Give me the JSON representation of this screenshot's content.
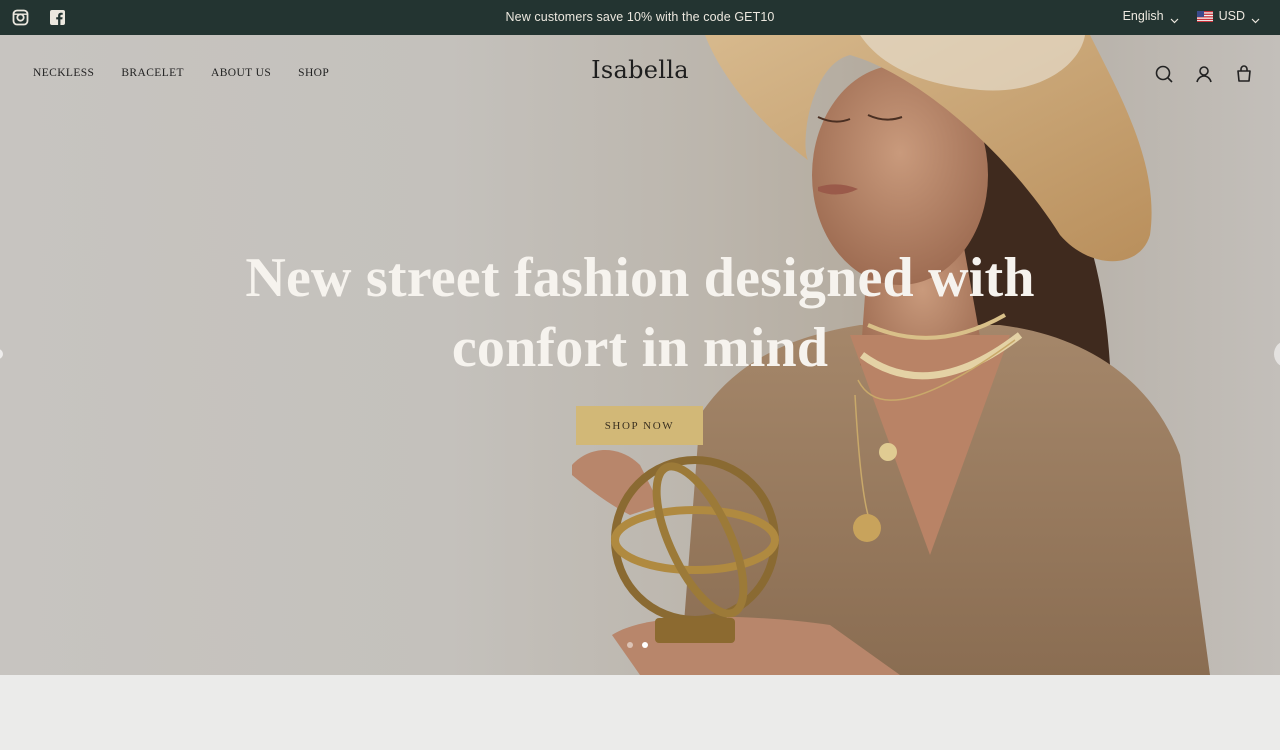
{
  "announcement": {
    "message": "New customers save 10% with the code GET10",
    "language": "English",
    "currency": "USD",
    "social_icons": [
      "instagram-icon",
      "facebook-icon"
    ],
    "background": "#233431"
  },
  "header": {
    "logo": "Isabella",
    "nav": [
      "NECKLESS",
      "BRACELET",
      "ABOUT US",
      "SHOP"
    ],
    "icons": [
      "search-icon",
      "account-icon",
      "cart-icon"
    ]
  },
  "hero": {
    "headline_line1": "New street fashion designed with",
    "headline_line2": "confort in mind",
    "cta_label": "SHOP NOW",
    "cta_color": "#d2b877",
    "slides_total": 2,
    "active_slide": 2
  }
}
